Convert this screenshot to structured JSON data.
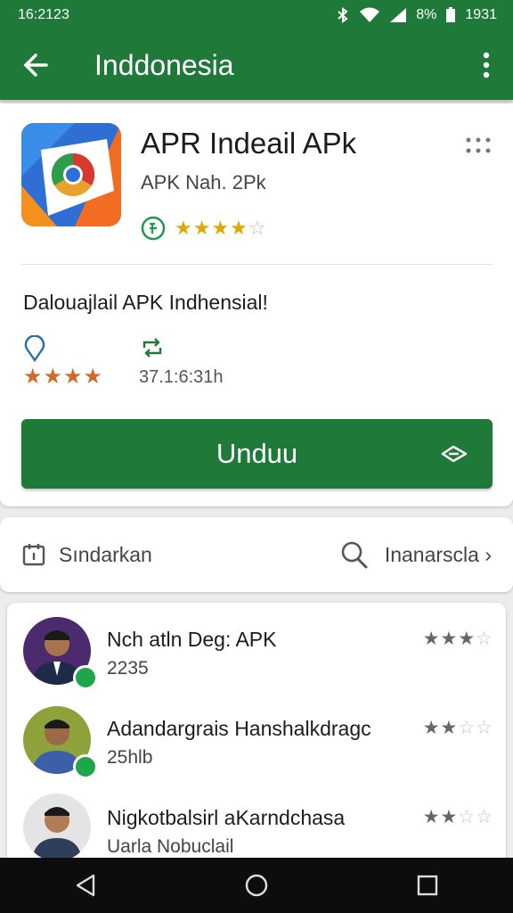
{
  "status": {
    "time": "16:2123",
    "battery": "8%",
    "clock": "1931"
  },
  "appbar": {
    "title": "Inddonesia",
    "back_icon": "arrow-left-icon",
    "menu_icon": "more-vert-icon"
  },
  "app": {
    "title": "APR Indeail APk",
    "subtitle": "APK Nah. 2Pk",
    "rating_stars": 4,
    "description": "Dalouajlail APK Indhensial!",
    "meta_rating_stars": 4,
    "meta_count": "37.1:6:31h",
    "download_label": "Unduu"
  },
  "actions": {
    "left_label": "Sındarkan",
    "right_label": "Inanarscla ›"
  },
  "reviews": [
    {
      "name": "Nch atln Deg: APK",
      "sub": "2235",
      "stars": 3
    },
    {
      "name": "Adandargrais Hanshalkdragc",
      "sub": "25hlb",
      "stars": 2
    },
    {
      "name": "Nigkotbalsirl aKarndchasa",
      "sub": "Uarla Nobuclail",
      "stars": 2
    }
  ],
  "colors": {
    "primary": "#1f7a3a",
    "star_gold": "#e1a800",
    "star_orange": "#d0692a"
  }
}
